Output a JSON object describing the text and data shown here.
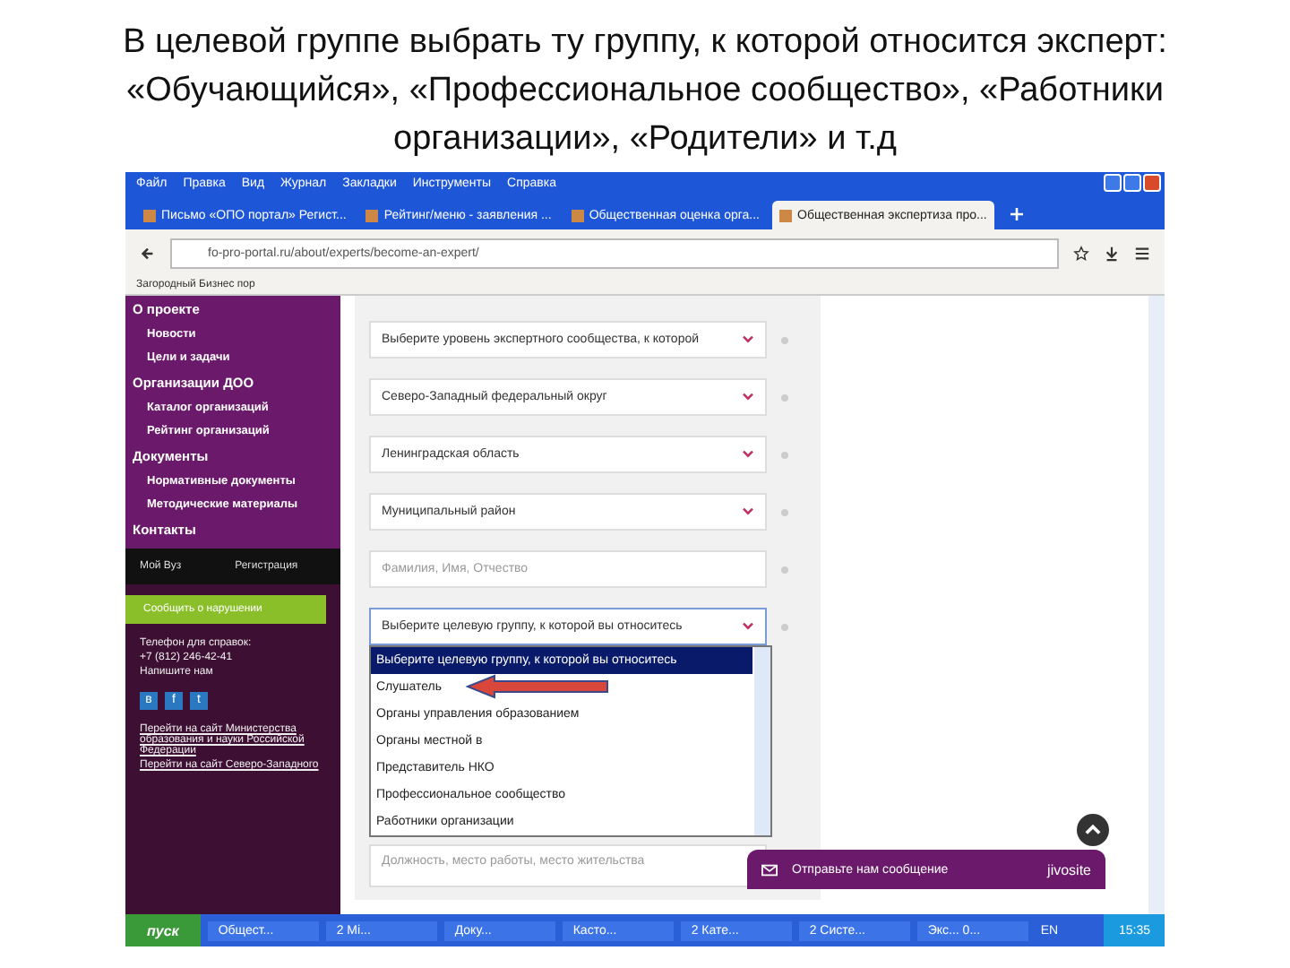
{
  "slide_title": "В целевой группе выбрать ту группу, к которой относится эксперт: «Обучающийся», «Профессиональное сообщество», «Работники организации», «Родители» и т.д",
  "browser": {
    "menu": [
      "Файл",
      "Правка",
      "Вид",
      "Журнал",
      "Закладки",
      "Инструменты",
      "Справка"
    ],
    "tabs": [
      {
        "label": "Письмо «ОПО портал» Регист...",
        "selected": false
      },
      {
        "label": "Рейтинг/меню - заявления ...",
        "selected": false
      },
      {
        "label": "Общественная оценка орга...",
        "selected": false
      },
      {
        "label": "Общественная экспертиза про...",
        "selected": true
      }
    ],
    "url": "fo-pro-portal.ru/about/experts/become-an-expert/",
    "bookmark": "Загородный Бизнес пор"
  },
  "sidebar": {
    "items": [
      {
        "label": "О проекте",
        "children": [
          {
            "label": "Новости"
          },
          {
            "label": "Цели и задачи"
          }
        ]
      },
      {
        "label": "Организации ДОО",
        "children": [
          {
            "label": "Каталог организаций"
          },
          {
            "label": "Рейтинг организаций"
          }
        ]
      },
      {
        "label": "Документы",
        "children": [
          {
            "label": "Нормативные документы"
          },
          {
            "label": "Методические материалы"
          }
        ]
      },
      {
        "label": "Контакты"
      }
    ],
    "account_links": [
      "Мой Вуз",
      "Регистрация"
    ],
    "feedback_button": "Сообщить о нарушении",
    "contact_lines": [
      "Телефон для справок:",
      "+7 (812) 246-42-41",
      "Напишите нам"
    ],
    "social": [
      "в",
      "f",
      "t"
    ],
    "links": [
      "Перейти на сайт Министерства образования и науки Российской Федерации",
      "Перейти на сайт Северо-Западного"
    ]
  },
  "form": {
    "fields": [
      {
        "kind": "select",
        "value": "Выберите уровень экспертного сообщества, к которой",
        "expanded": false
      },
      {
        "kind": "select",
        "value": "Северо-Западный федеральный округ",
        "expanded": false
      },
      {
        "kind": "select",
        "value": "Ленинградская область",
        "expanded": false
      },
      {
        "kind": "select",
        "value": "Муниципальный район",
        "expanded": false
      },
      {
        "kind": "input",
        "placeholder": "Фамилия, Имя, Отчество"
      },
      {
        "kind": "select",
        "value": "Выберите целевую группу, к которой вы относитесь",
        "expanded": true
      }
    ],
    "options": [
      {
        "label": "Выберите целевую группу, к которой вы относитесь",
        "selected": true
      },
      {
        "label": "Слушатель",
        "selected": false
      },
      {
        "label": "Органы управления образованием",
        "selected": false
      },
      {
        "label": "Органы местной в",
        "selected": false
      },
      {
        "label": "Представитель НКО",
        "selected": false
      },
      {
        "label": "Профессиональное сообщество",
        "selected": false
      },
      {
        "label": "Работники организации",
        "selected": false
      }
    ],
    "textarea_placeholder": "Должность, место работы, место жительства"
  },
  "chat": {
    "label": "Отправьте нам сообщение",
    "brand": "jivosite"
  },
  "taskbar": {
    "start": "пуск",
    "items": [
      "Общест...",
      "2 Mi...",
      "Доку...",
      "Касто...",
      "2 Кате...",
      "2 Систе...",
      "Экс... 0..."
    ],
    "language": "EN",
    "clock": "15:35"
  }
}
